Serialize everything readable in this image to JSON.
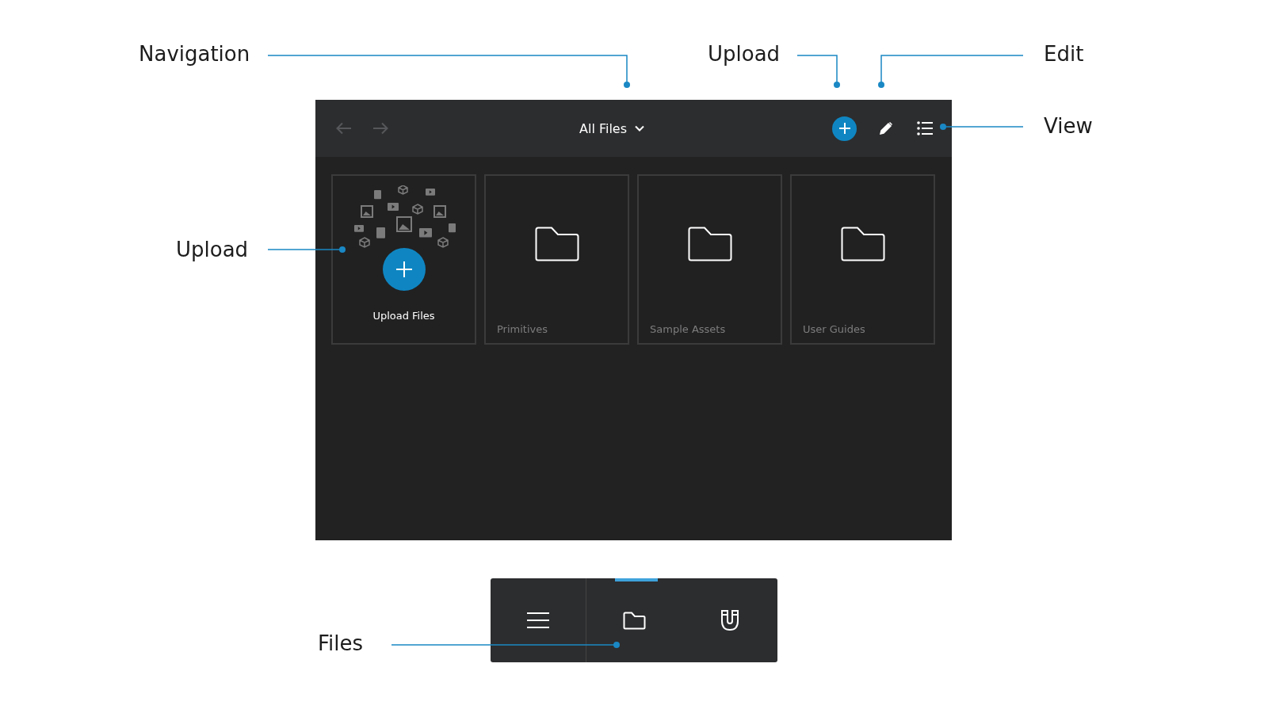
{
  "callouts": [
    {
      "label": "Navigation"
    },
    {
      "label": "Upload"
    },
    {
      "label": "Edit"
    },
    {
      "label": "View"
    },
    {
      "label": "Upload"
    },
    {
      "label": "Files"
    }
  ],
  "toolbar": {
    "title": "All Files"
  },
  "upload_card": {
    "label": "Upload Files"
  },
  "folders": [
    {
      "name": "Primitives"
    },
    {
      "name": "Sample Assets"
    },
    {
      "name": "User Guides"
    }
  ],
  "bottom_bar": {
    "tabs": [
      {
        "kind": "menu",
        "selected": false
      },
      {
        "kind": "files",
        "selected": true
      },
      {
        "kind": "magnet",
        "selected": false
      }
    ]
  }
}
